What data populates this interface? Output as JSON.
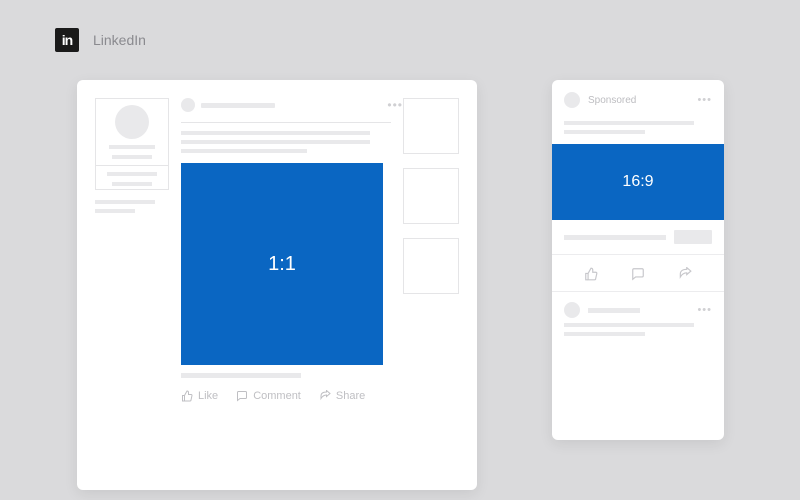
{
  "brand": {
    "name": "LinkedIn",
    "logo_text": "in"
  },
  "desktop": {
    "hero_ratio": "1:1",
    "actions": {
      "like": "Like",
      "comment": "Comment",
      "share": "Share"
    }
  },
  "mobile": {
    "sponsored_label": "Sponsored",
    "hero_ratio": "16:9"
  }
}
